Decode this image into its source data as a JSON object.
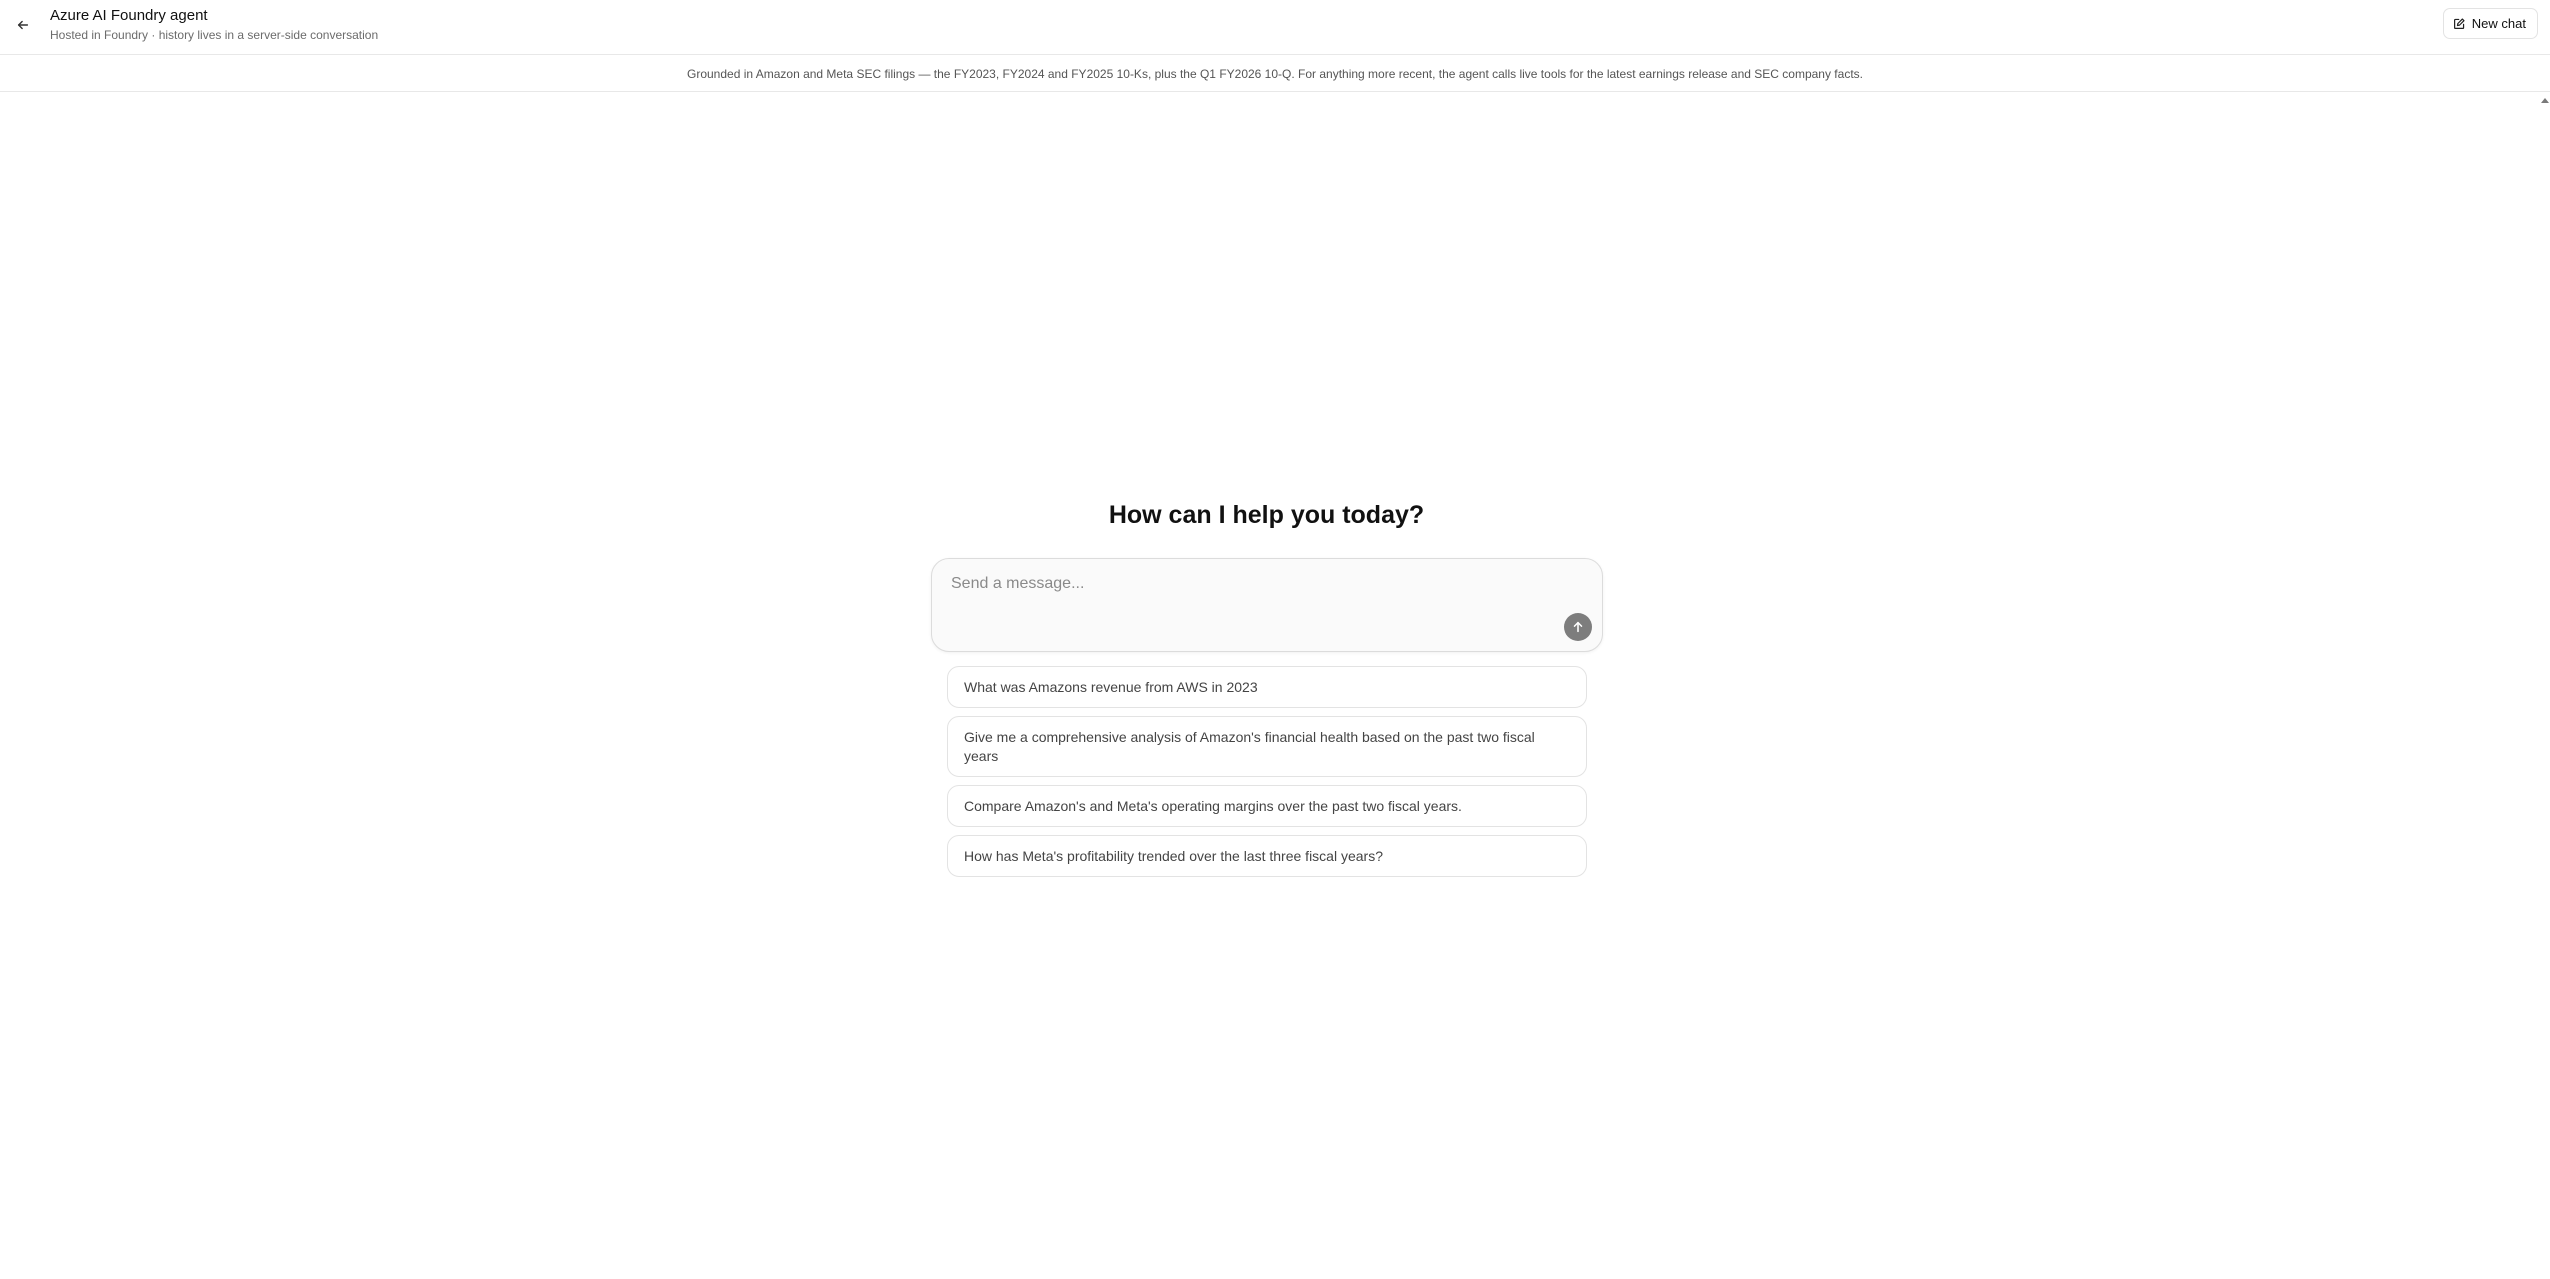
{
  "header": {
    "title": "Azure AI Foundry agent",
    "subtitle": "Hosted in Foundry · history lives in a server-side conversation",
    "back_icon": "arrow-left-icon",
    "new_chat_label": "New chat",
    "new_chat_icon": "edit-icon"
  },
  "banner": {
    "text": "Grounded in Amazon and Meta SEC filings — the FY2023, FY2024 and FY2025 10-Ks, plus the Q1 FY2026 10-Q. For anything more recent, the agent calls live tools for the latest earnings release and SEC company facts."
  },
  "main": {
    "greeting": "How can I help you today?",
    "composer": {
      "placeholder": "Send a message...",
      "value": "",
      "send_icon": "arrow-up-icon"
    },
    "suggestions": [
      {
        "label": "What was Amazons revenue from AWS in 2023"
      },
      {
        "label": "Give me a comprehensive analysis of Amazon's financial health based on the past two fiscal years"
      },
      {
        "label": "Compare Amazon's and Meta's operating margins over the past two fiscal years."
      },
      {
        "label": "How has Meta's profitability trended over the last three fiscal years?"
      }
    ]
  },
  "colors": {
    "send_button": "#7d7d7d",
    "border": "#e3e3e3",
    "composer_bg": "#fafafa"
  }
}
